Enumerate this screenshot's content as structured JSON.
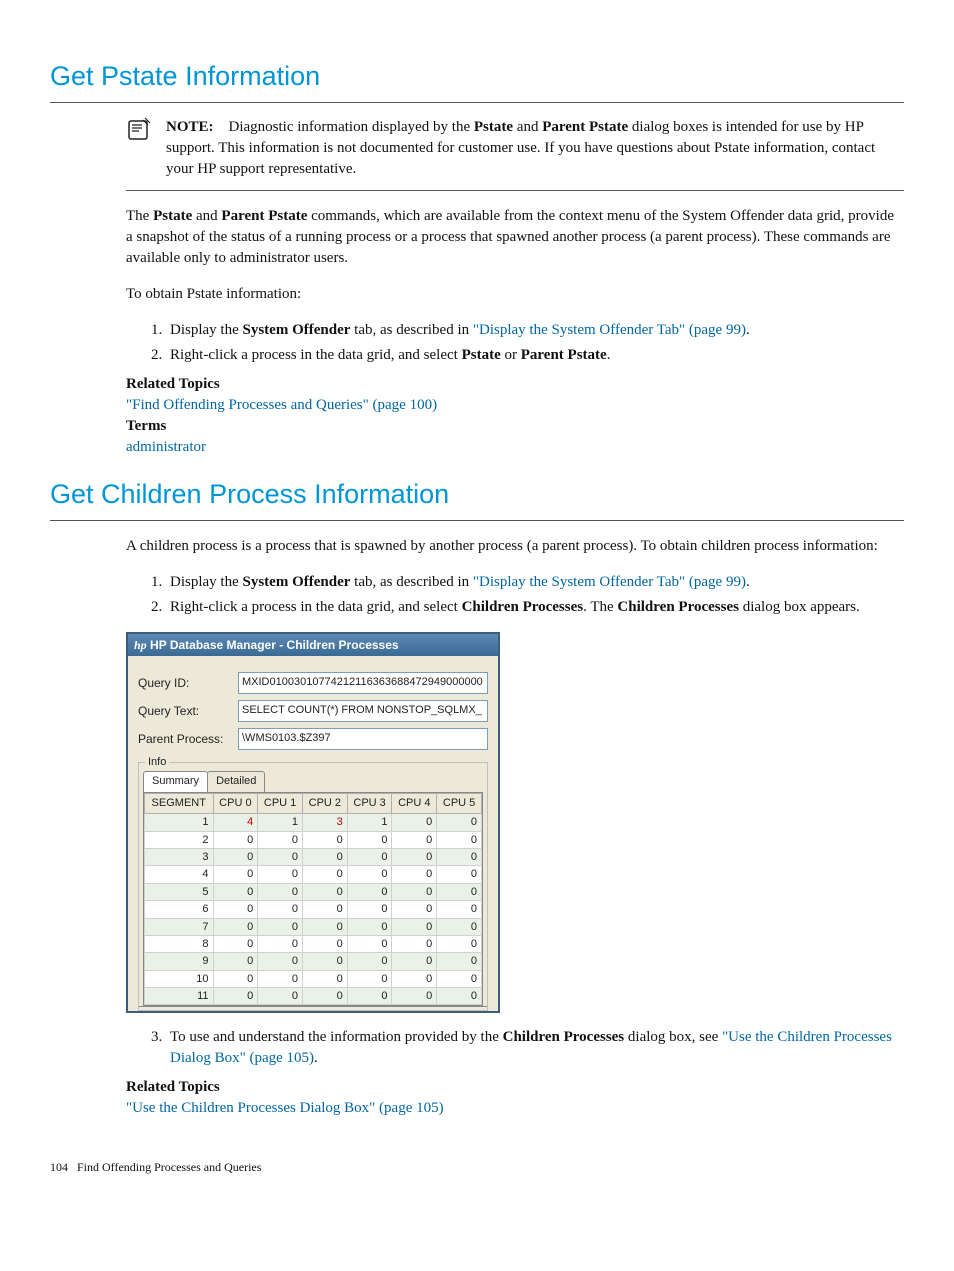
{
  "section1": {
    "title": "Get Pstate Information",
    "note_label": "NOTE:",
    "note_text_parts": {
      "p1": "Diagnostic information displayed by the ",
      "b1": "Pstate",
      "p2": " and ",
      "b2": "Parent Pstate",
      "p3": " dialog boxes is intended for use by HP support. This information is not documented for customer use. If you have questions about Pstate information, contact your HP support representative."
    },
    "para1_parts": {
      "p1": "The ",
      "b1": "Pstate",
      "p2": " and ",
      "b2": "Parent Pstate",
      "p3": " commands, which are available from the context menu of the System Offender data grid, provide a snapshot of the status of a running process or a process that spawned another process (a parent process). These commands are available only to administrator users."
    },
    "para2": "To obtain Pstate information:",
    "step1_parts": {
      "p1": "Display the ",
      "b1": "System Offender",
      "p2": " tab, as described in ",
      "link": "\"Display the System Offender Tab\" (page 99)",
      "p3": "."
    },
    "step2_parts": {
      "p1": "Right-click a process in the data grid, and select ",
      "b1": "Pstate",
      "p2": " or ",
      "b2": "Parent Pstate",
      "p3": "."
    },
    "related_label": "Related Topics",
    "related_link": "\"Find Offending Processes and Queries\" (page 100)",
    "terms_label": "Terms",
    "terms_link": "administrator"
  },
  "section2": {
    "title": "Get Children Process Information",
    "intro": "A children process is a process that is spawned by another process (a parent process). To obtain children process information:",
    "step1_parts": {
      "p1": "Display the ",
      "b1": "System Offender",
      "p2": " tab, as described in ",
      "link": "\"Display the System Offender Tab\" (page 99)",
      "p3": "."
    },
    "step2_parts": {
      "p1": "Right-click a process in the data grid, and select ",
      "b1": "Children Processes",
      "p2": ". The ",
      "b2": "Children Processes",
      "p3": " dialog box appears."
    },
    "step3_parts": {
      "p1": "To use and understand the information provided by the ",
      "b1": "Children Processes",
      "p2": " dialog box, see ",
      "link": "\"Use the Children Processes Dialog Box\" (page 105)",
      "p3": "."
    },
    "related_label": "Related Topics",
    "related_link": "\"Use the Children Processes Dialog Box\" (page 105)"
  },
  "dialog": {
    "title": "HP Database Manager - Children Processes",
    "query_id_label": "Query ID:",
    "query_id_value": "MXID01003010774212116363688472949000000",
    "query_text_label": "Query Text:",
    "query_text_value": "SELECT COUNT(*) FROM NONSTOP_SQLMX_",
    "parent_process_label": "Parent Process:",
    "parent_process_value": "\\WMS0103.$Z397",
    "info_legend": "Info",
    "tab_summary": "Summary",
    "tab_detailed": "Detailed",
    "columns": [
      "SEGMENT",
      "CPU 0",
      "CPU 1",
      "CPU 2",
      "CPU 3",
      "CPU 4",
      "CPU 5"
    ],
    "rows": [
      {
        "seg": "1",
        "c": [
          "4",
          "1",
          "3",
          "1",
          "0",
          "0"
        ],
        "red": [
          0,
          2
        ]
      },
      {
        "seg": "2",
        "c": [
          "0",
          "0",
          "0",
          "0",
          "0",
          "0"
        ]
      },
      {
        "seg": "3",
        "c": [
          "0",
          "0",
          "0",
          "0",
          "0",
          "0"
        ]
      },
      {
        "seg": "4",
        "c": [
          "0",
          "0",
          "0",
          "0",
          "0",
          "0"
        ]
      },
      {
        "seg": "5",
        "c": [
          "0",
          "0",
          "0",
          "0",
          "0",
          "0"
        ]
      },
      {
        "seg": "6",
        "c": [
          "0",
          "0",
          "0",
          "0",
          "0",
          "0"
        ]
      },
      {
        "seg": "7",
        "c": [
          "0",
          "0",
          "0",
          "0",
          "0",
          "0"
        ]
      },
      {
        "seg": "8",
        "c": [
          "0",
          "0",
          "0",
          "0",
          "0",
          "0"
        ]
      },
      {
        "seg": "9",
        "c": [
          "0",
          "0",
          "0",
          "0",
          "0",
          "0"
        ]
      },
      {
        "seg": "10",
        "c": [
          "0",
          "0",
          "0",
          "0",
          "0",
          "0"
        ]
      },
      {
        "seg": "11",
        "c": [
          "0",
          "0",
          "0",
          "0",
          "0",
          "0"
        ]
      }
    ]
  },
  "footer": {
    "page": "104",
    "chapter": "Find Offending Processes and Queries"
  },
  "chart_data": {
    "type": "table",
    "title": "Children Processes — Summary",
    "columns": [
      "SEGMENT",
      "CPU 0",
      "CPU 1",
      "CPU 2",
      "CPU 3",
      "CPU 4",
      "CPU 5"
    ],
    "rows": [
      [
        1,
        4,
        1,
        3,
        1,
        0,
        0
      ],
      [
        2,
        0,
        0,
        0,
        0,
        0,
        0
      ],
      [
        3,
        0,
        0,
        0,
        0,
        0,
        0
      ],
      [
        4,
        0,
        0,
        0,
        0,
        0,
        0
      ],
      [
        5,
        0,
        0,
        0,
        0,
        0,
        0
      ],
      [
        6,
        0,
        0,
        0,
        0,
        0,
        0
      ],
      [
        7,
        0,
        0,
        0,
        0,
        0,
        0
      ],
      [
        8,
        0,
        0,
        0,
        0,
        0,
        0
      ],
      [
        9,
        0,
        0,
        0,
        0,
        0,
        0
      ],
      [
        10,
        0,
        0,
        0,
        0,
        0,
        0
      ],
      [
        11,
        0,
        0,
        0,
        0,
        0,
        0
      ]
    ]
  }
}
